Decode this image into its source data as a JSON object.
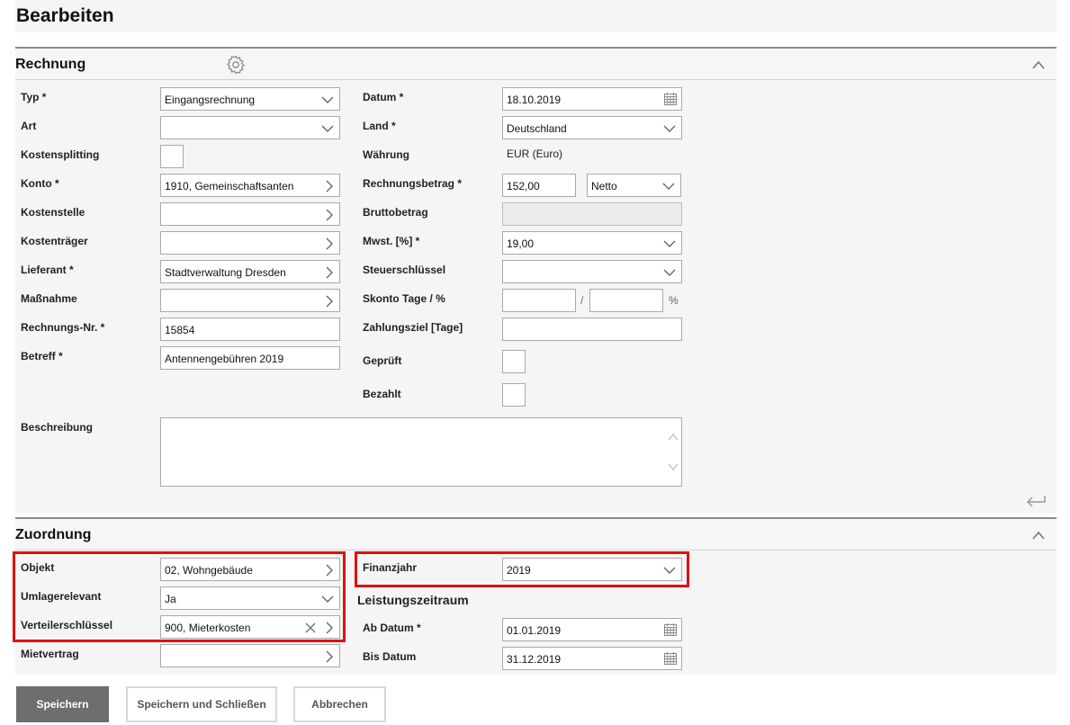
{
  "page": {
    "title": "Bearbeiten"
  },
  "rechnung": {
    "title": "Rechnung",
    "typ": {
      "label": "Typ *",
      "value": "Eingangsrechnung"
    },
    "art": {
      "label": "Art",
      "value": ""
    },
    "kostensplitting": {
      "label": "Kostensplitting",
      "checked": false
    },
    "konto": {
      "label": "Konto *",
      "value": "1910, Gemeinschaftsanten"
    },
    "kostenstelle": {
      "label": "Kostenstelle",
      "value": ""
    },
    "kostentraeger": {
      "label": "Kostenträger",
      "value": ""
    },
    "lieferant": {
      "label": "Lieferant *",
      "value": "Stadtverwaltung Dresden"
    },
    "massnahme": {
      "label": "Maßnahme",
      "value": ""
    },
    "rechnungs_nr": {
      "label": "Rechnungs-Nr. *",
      "value": "15854"
    },
    "betreff": {
      "label": "Betreff *",
      "value": "Antennengebühren 2019"
    },
    "datum": {
      "label": "Datum *",
      "value": "18.10.2019"
    },
    "land": {
      "label": "Land *",
      "value": "Deutschland"
    },
    "waehrung": {
      "label": "Währung",
      "value": "EUR (Euro)"
    },
    "rechnungsbetrag": {
      "label": "Rechnungsbetrag *",
      "value": "152,00",
      "mode": "Netto"
    },
    "bruttobetrag": {
      "label": "Bruttobetrag",
      "value": ""
    },
    "mwst": {
      "label": "Mwst. [%] *",
      "value": "19,00"
    },
    "steuerschluessel": {
      "label": "Steuerschlüssel",
      "value": ""
    },
    "skonto": {
      "label": "Skonto Tage / %",
      "tage": "",
      "prozent": "",
      "separator": "/",
      "unit": "%"
    },
    "zahlungsziel": {
      "label": "Zahlungsziel [Tage]",
      "value": ""
    },
    "geprueft": {
      "label": "Geprüft",
      "checked": false
    },
    "bezahlt": {
      "label": "Bezahlt",
      "checked": false
    },
    "beschreibung": {
      "label": "Beschreibung",
      "value": ""
    }
  },
  "zuordnung": {
    "title": "Zuordnung",
    "objekt": {
      "label": "Objekt",
      "value": "02, Wohngebäude"
    },
    "umlagerelevant": {
      "label": "Umlagerelevant",
      "value": "Ja"
    },
    "verteilerschluessel": {
      "label": "Verteilerschlüssel",
      "value": "900, Mieterkosten"
    },
    "mietvertrag": {
      "label": "Mietvertrag",
      "value": ""
    },
    "finanzjahr": {
      "label": "Finanzjahr",
      "value": "2019"
    },
    "leistungszeitraum": {
      "title": "Leistungszeitraum",
      "ab_datum": {
        "label": "Ab Datum *",
        "value": "01.01.2019"
      },
      "bis_datum": {
        "label": "Bis Datum",
        "value": "31.12.2019"
      }
    }
  },
  "buttons": {
    "save": "Speichern",
    "save_close": "Speichern und Schließen",
    "cancel": "Abbrechen"
  },
  "colors": {
    "highlight": "#e01010",
    "primary_button": "#6e6e6e",
    "section_bg": "#f5f5f5"
  },
  "icons": [
    "gear-icon",
    "chevron-up-icon",
    "chevron-down-icon",
    "chevron-right-icon",
    "calendar-icon",
    "clear-icon",
    "return-icon"
  ]
}
